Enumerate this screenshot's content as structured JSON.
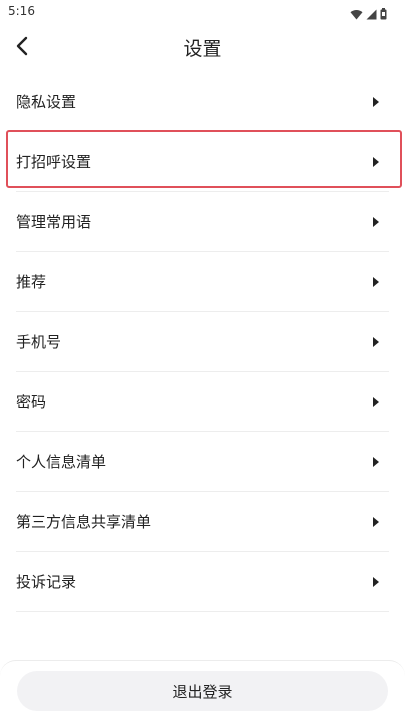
{
  "status_bar": {
    "time": "5:16",
    "icons": [
      "wifi-icon",
      "signal-icon",
      "battery-icon"
    ]
  },
  "header": {
    "title": "设置",
    "back_icon": "chevron-left-icon"
  },
  "settings": {
    "items": [
      {
        "label": "隐私设置"
      },
      {
        "label": "打招呼设置",
        "highlighted": true
      },
      {
        "label": "管理常用语"
      },
      {
        "label": "推荐"
      },
      {
        "label": "手机号"
      },
      {
        "label": "密码"
      },
      {
        "label": "个人信息清单"
      },
      {
        "label": "第三方信息共享清单"
      },
      {
        "label": "投诉记录"
      }
    ],
    "arrow_icon": "caret-right-icon"
  },
  "footer": {
    "logout_label": "退出登录"
  },
  "colors": {
    "highlight": "#e0505a",
    "button_bg": "#f2f2f4",
    "divider": "#ededed"
  }
}
